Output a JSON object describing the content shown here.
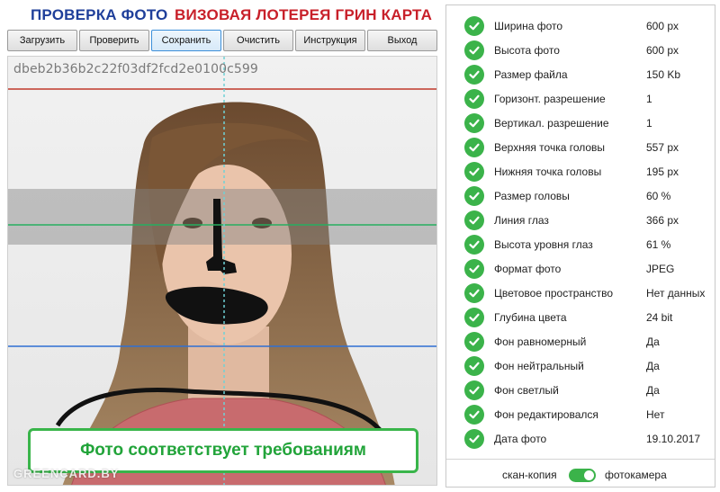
{
  "header": {
    "title_left": "ПРОВЕРКА ФОТО",
    "title_right": "ВИЗОВАЯ ЛОТЕРЕЯ ГРИН КАРТА"
  },
  "toolbar": {
    "buttons": [
      "Загрузить",
      "Проверить",
      "Сохранить",
      "Очистить",
      "Инструкция",
      "Выход"
    ],
    "active": "Сохранить"
  },
  "photo": {
    "hash": "dbeb2b36b2c22f03df2fcd2e0100c599",
    "status": "Фото соответствует требованиям",
    "watermark": "GREENCARD.BY"
  },
  "checks": [
    {
      "label": "Ширина фото",
      "value": "600 px"
    },
    {
      "label": "Высота фото",
      "value": "600 px"
    },
    {
      "label": "Размер файла",
      "value": "150 Kb"
    },
    {
      "label": "Горизонт. разрешение",
      "value": "1"
    },
    {
      "label": "Вертикал. разрешение",
      "value": "1"
    },
    {
      "label": "Верхняя точка головы",
      "value": "557 px"
    },
    {
      "label": "Нижняя точка головы",
      "value": "195 px"
    },
    {
      "label": "Размер головы",
      "value": "60 %"
    },
    {
      "label": "Линия глаз",
      "value": "366 px"
    },
    {
      "label": "Высота уровня глаз",
      "value": "61 %"
    },
    {
      "label": "Формат фото",
      "value": "JPEG"
    },
    {
      "label": "Цветовое пространство",
      "value": "Нет данных"
    },
    {
      "label": "Глубина цвета",
      "value": "24 bit"
    },
    {
      "label": "Фон равномерный",
      "value": "Да"
    },
    {
      "label": "Фон нейтральный",
      "value": "Да"
    },
    {
      "label": "Фон светлый",
      "value": "Да"
    },
    {
      "label": "Фон редактировался",
      "value": "Нет"
    },
    {
      "label": "Дата фото",
      "value": "19.10.2017"
    }
  ],
  "source_toggle": {
    "left": "скан-копия",
    "right": "фотокамера",
    "on": true
  },
  "colors": {
    "ok_green": "#3bb34a",
    "title_blue": "#1f3f9a",
    "title_red": "#c8202a"
  }
}
